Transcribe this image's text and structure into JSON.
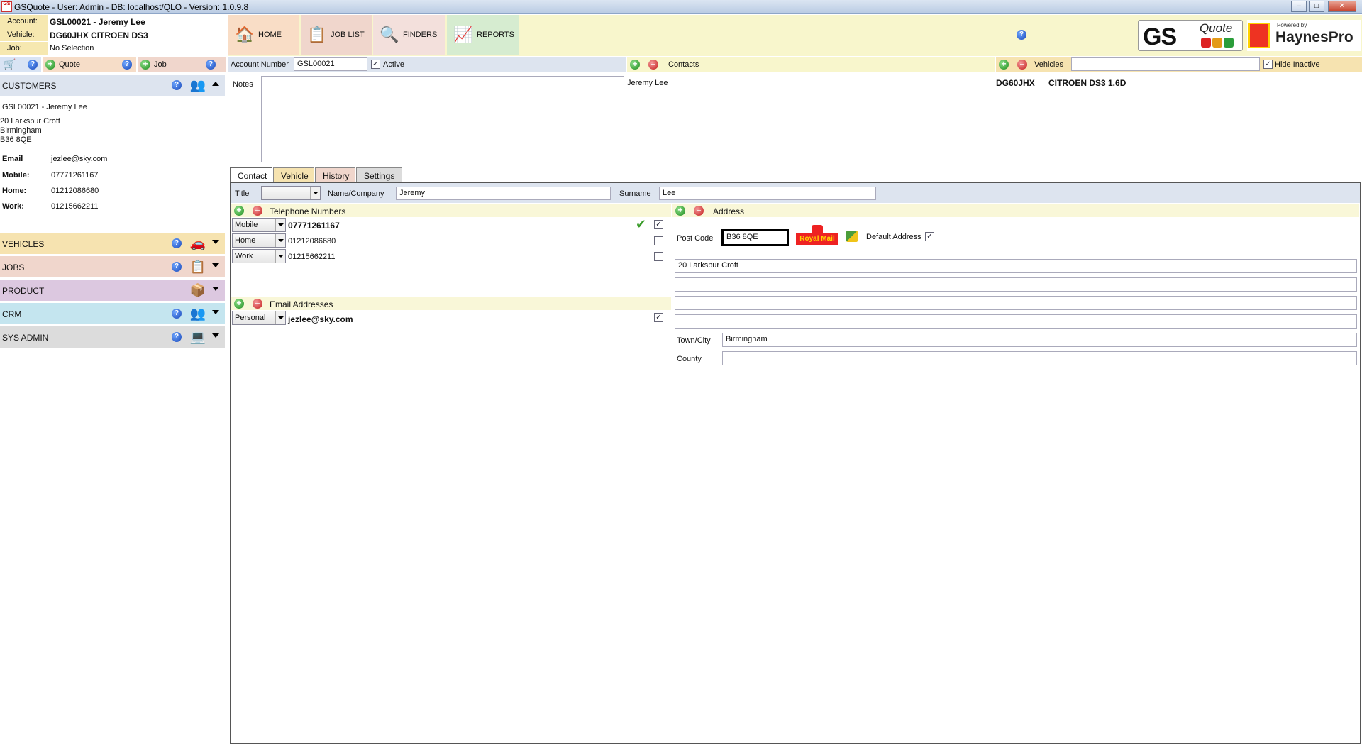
{
  "window": {
    "title": "GSQuote - User: Admin - DB: localhost/QLO - Version: 1.0.9.8",
    "app_icon": "GS"
  },
  "account_panel": {
    "account_label": "Account:",
    "account_value": "GSL00021 - Jeremy Lee",
    "vehicle_label": "Vehicle:",
    "vehicle_value": "DG60JHX CITROEN DS3",
    "job_label": "Job:",
    "job_value": "No Selection"
  },
  "toolbar": {
    "home": "HOME",
    "job_list": "JOB LIST",
    "finders": "FINDERS",
    "reports": "REPORTS",
    "logo_gs": "GS",
    "logo_quote": "Quote",
    "logo_powered": "Powered by",
    "logo_haynes": "HaynesPro"
  },
  "left_actions": {
    "quote": "Quote",
    "job": "Job"
  },
  "sections": {
    "customers": "CUSTOMERS",
    "vehicles": "VEHICLES",
    "jobs": "JOBS",
    "product": "PRODUCT",
    "crm": "CRM",
    "sys_admin": "SYS ADMIN"
  },
  "customer": {
    "header": "GSL00021 - Jeremy Lee",
    "address1": "20 Larkspur Croft",
    "address2": "Birmingham",
    "address3": "B36 8QE",
    "email_label": "Email",
    "email": "jezlee@sky.com",
    "mobile_label": "Mobile:",
    "mobile": "07771261167",
    "home_label": "Home:",
    "home": "01212086680",
    "work_label": "Work:",
    "work": "01215662211"
  },
  "account_form": {
    "account_number_label": "Account Number",
    "account_number": "GSL00021",
    "active_label": "Active",
    "notes_label": "Notes",
    "contacts_label": "Contacts",
    "contact_name": "Jeremy Lee",
    "vehicles_label": "Vehicles",
    "hide_inactive_label": "Hide Inactive",
    "vehicle_reg": "DG60JHX",
    "vehicle_model": "CITROEN DS3 1.6D"
  },
  "tabs": [
    "Contact",
    "Vehicle",
    "History",
    "Settings"
  ],
  "contact": {
    "title_label": "Title",
    "title_value": "",
    "name_label": "Name/Company",
    "name_value": "Jeremy",
    "surname_label": "Surname",
    "surname_value": "Lee",
    "telephone_header": "Telephone Numbers",
    "phones": [
      {
        "type": "Mobile",
        "number": "07771261167"
      },
      {
        "type": "Home",
        "number": "01212086680"
      },
      {
        "type": "Work",
        "number": "01215662211"
      }
    ],
    "email_header": "Email Addresses",
    "email_type": "Personal",
    "email_value": "jezlee@sky.com",
    "address_header": "Address",
    "postcode_label": "Post Code",
    "postcode_value": "B36 8QE",
    "royal_mail": "Royal Mail",
    "default_address_label": "Default Address",
    "address_line1": "20 Larkspur Croft",
    "address_line2": "",
    "address_line3": "",
    "address_line4": "",
    "town_label": "Town/City",
    "town_value": "Birmingham",
    "county_label": "County",
    "county_value": ""
  },
  "colors": {
    "customers": "#dde4ef",
    "vehicles": "#f6e3b0",
    "jobs": "#f0d6cc",
    "product": "#dcc8e0",
    "crm": "#c4e5ef",
    "sys_admin": "#dcdcdc"
  }
}
